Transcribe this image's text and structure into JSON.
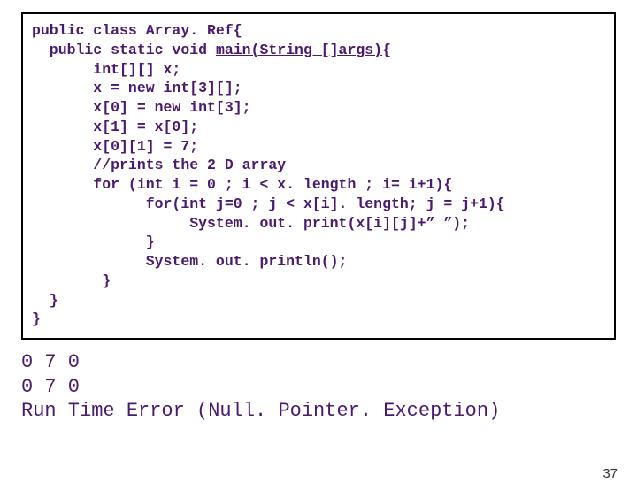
{
  "code": {
    "lines": [
      "public class Array. Ref{",
      "  public static void main(String []args){",
      "       int[][] x;",
      "       x = new int[3][];",
      "       x[0] = new int[3];",
      "       x[1] = x[0];",
      "       x[0][1] = 7;",
      "       //prints the 2 D array",
      "       for (int i = 0 ; i < x. length ; i= i+1){",
      "             for(int j=0 ; j < x[i]. length; j = j+1){",
      "                  System. out. print(x[i][j]+” ”);",
      "             }",
      "             System. out. println();",
      "        }",
      "  }",
      "}"
    ],
    "underline_segment": "main(String []args)"
  },
  "output": {
    "line1": "0 7 0",
    "line2": "0 7 0",
    "line3": "Run Time Error (Null. Pointer. Exception)"
  },
  "slide_number": "37"
}
